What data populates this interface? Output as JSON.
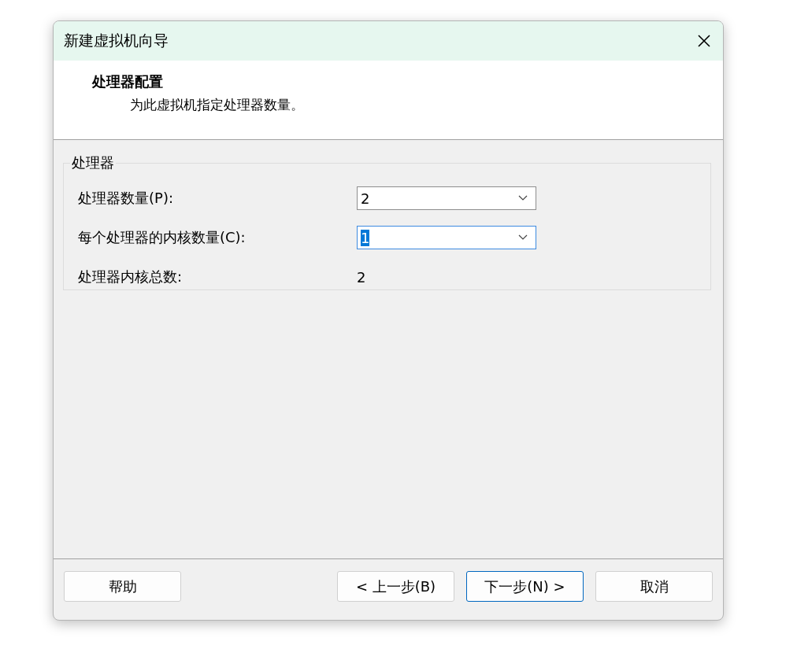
{
  "window": {
    "title": "新建虚拟机向导"
  },
  "header": {
    "title": "处理器配置",
    "subtitle": "为此虚拟机指定处理器数量。"
  },
  "group": {
    "title": "处理器",
    "fields": [
      {
        "kind": "dropdown",
        "label": "处理器数量(P):",
        "value": "2",
        "value_selected": false
      },
      {
        "kind": "dropdown",
        "label": "每个处理器的内核数量(C):",
        "value": "1",
        "value_selected": true
      },
      {
        "kind": "readout",
        "label": "处理器内核总数:",
        "value": "2"
      }
    ]
  },
  "footer": {
    "left_buttons": [
      {
        "label": "帮助",
        "default": false
      }
    ],
    "right_buttons": [
      {
        "label": "< 上一步(B)",
        "default": false
      },
      {
        "label": "下一步(N) >",
        "default": true
      },
      {
        "label": "取消",
        "default": false
      }
    ]
  }
}
